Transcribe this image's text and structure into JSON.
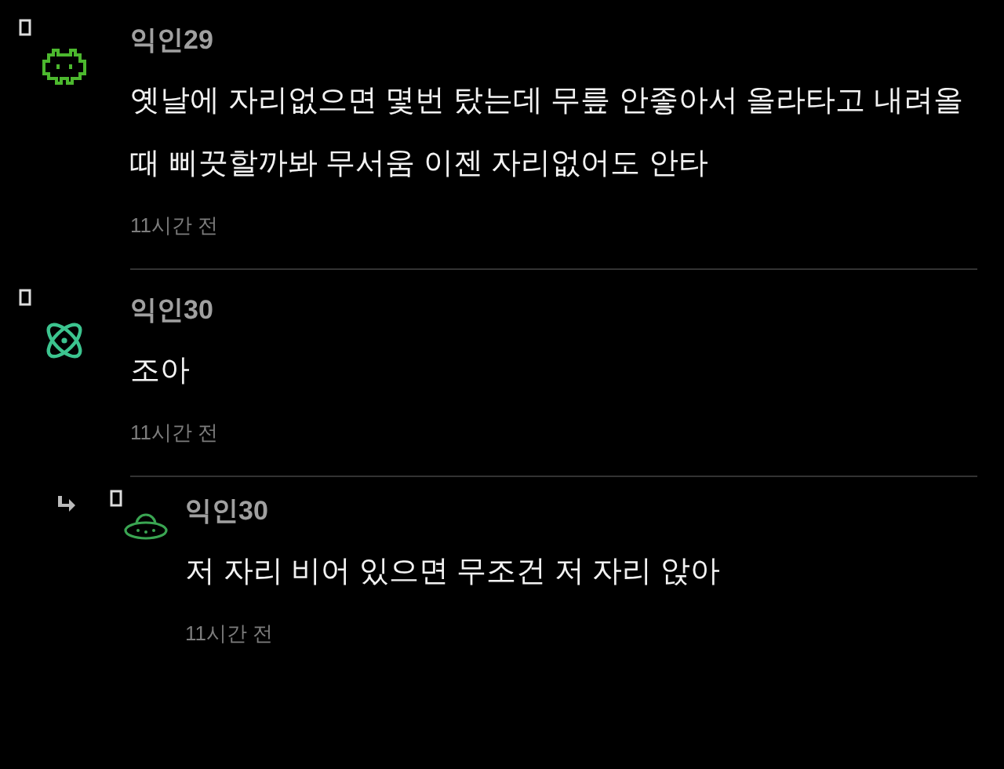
{
  "comments": [
    {
      "author": "익인29",
      "kind": "invader",
      "color": "#4cb82e",
      "body": "옛날에 자리없으면 몇번 탔는데 무릎 안좋아서 올라타고 내려올때 삐끗할까봐 무서움 이젠 자리없어도 안타",
      "time": "11시간 전"
    },
    {
      "author": "익인30",
      "kind": "atom",
      "color": "#3cc48f",
      "body": "조아",
      "time": "11시간 전",
      "children": [
        {
          "author": "익인30",
          "kind": "ufo",
          "color": "#3aa552",
          "body": "저 자리 비어 있으면 무조건 저 자리 앉아",
          "time": "11시간 전"
        }
      ]
    }
  ]
}
